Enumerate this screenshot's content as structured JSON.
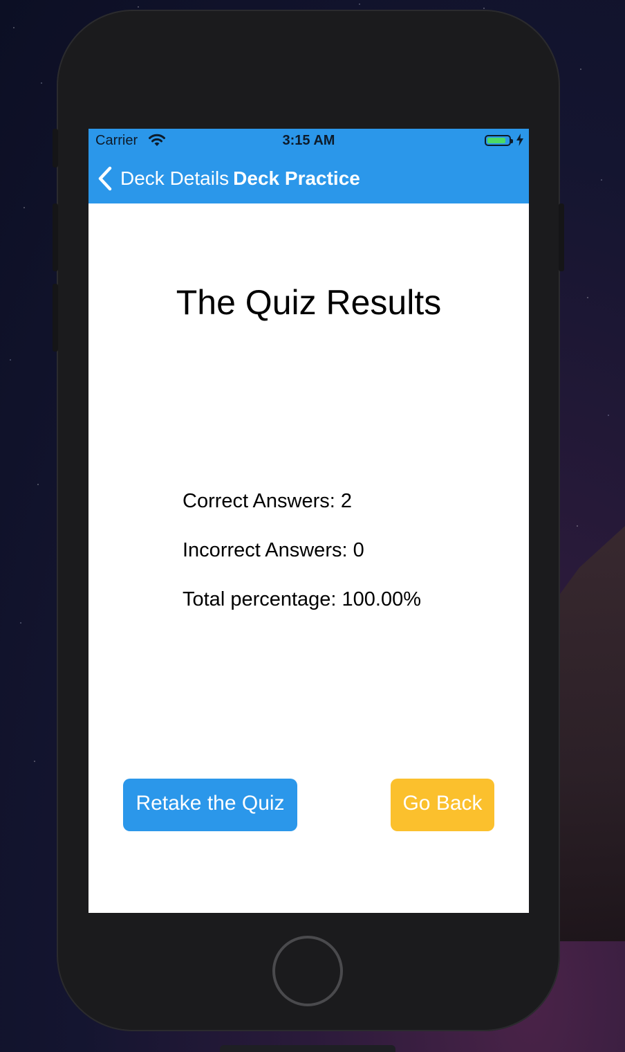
{
  "status_bar": {
    "carrier": "Carrier",
    "time": "3:15 AM",
    "wifi_icon": "wifi-icon",
    "battery_icon": "battery-charging-icon"
  },
  "nav": {
    "back_label": "Deck Details",
    "title": "Deck Practice",
    "back_icon": "chevron-left-icon"
  },
  "results": {
    "title": "The Quiz Results",
    "correct": "Correct Answers: 2",
    "incorrect": "Incorrect Answers: 0",
    "percentage": "Total percentage: 100.00%"
  },
  "actions": {
    "retake_label": "Retake the Quiz",
    "go_back_label": "Go Back"
  },
  "colors": {
    "header": "#2b97ea",
    "retake_button": "#2b97ea",
    "go_back_button": "#fbc02d",
    "battery_level": "#4cd964"
  }
}
